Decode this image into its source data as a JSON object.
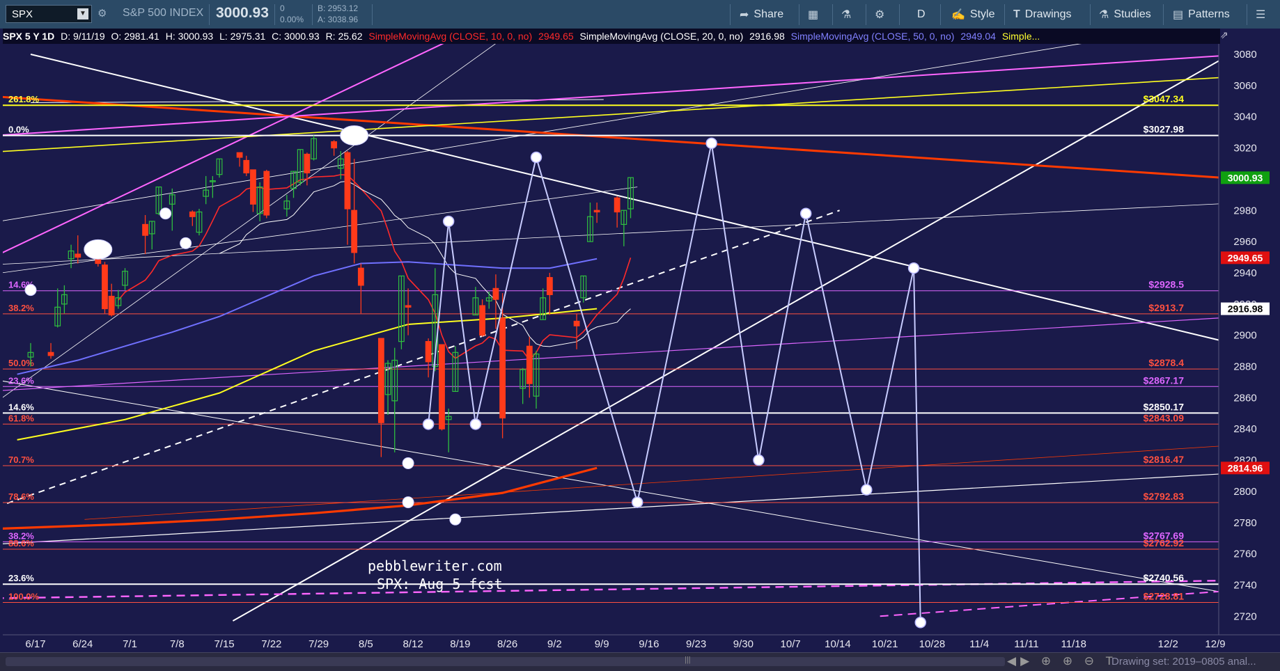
{
  "toolbar": {
    "symbol": "SPX",
    "index_name": "S&P 500 INDEX",
    "last_price": "3000.93",
    "change": "0",
    "change_pct": "0.00%",
    "bid": "B: 2953.12",
    "ask": "A: 3038.96",
    "buttons": {
      "share": "Share",
      "period": "D",
      "style": "Style",
      "drawings": "Drawings",
      "studies": "Studies",
      "patterns": "Patterns"
    }
  },
  "legend": {
    "header": "SPX 5 Y 1D",
    "date": "D: 9/11/19",
    "open": "O: 2981.41",
    "high": "H: 3000.93",
    "low": "L: 2975.31",
    "close": "C: 3000.93",
    "range": "R: 25.62",
    "sma10_label": "SimpleMovingAvg (CLOSE, 10, 0, no)",
    "sma10_value": "2949.65",
    "sma20_label": "SimpleMovingAvg (CLOSE, 20, 0, no)",
    "sma20_value": "2916.98",
    "sma50_label": "SimpleMovingAvg (CLOSE, 50, 0, no)",
    "sma50_value": "2949.04",
    "more": "Simple..."
  },
  "status_bar": {
    "drawing_set": "Drawing set: 2019–0805 anal..."
  },
  "colors": {
    "background": "#1a1a4a",
    "up": "#2fbf3f",
    "down": "#ff3a1a",
    "sma10": "#ff2a2a",
    "sma20": "#ffffff",
    "sma50": "#7070ff",
    "sma100": "#ffff20",
    "sma200": "#ff3a00",
    "fib_red": "#ff5040",
    "fib_violet": "#dd66ff",
    "forecast": "#c8ccff"
  },
  "chart_data": {
    "type": "candlestick",
    "symbol": "SPX",
    "aggregation": "1D",
    "yaxis": {
      "ticks": [
        2720,
        2740,
        2760,
        2780,
        2800,
        2820,
        2840,
        2860,
        2880,
        2900,
        2920,
        2940,
        2960,
        2980,
        3000,
        3020,
        3040,
        3060,
        3080
      ],
      "range": [
        2716,
        3084
      ]
    },
    "xaxis": {
      "tick_labels": [
        "6/17",
        "6/24",
        "7/1",
        "7/8",
        "7/15",
        "7/22",
        "7/29",
        "8/5",
        "8/12",
        "8/19",
        "8/26",
        "9/2",
        "9/9",
        "9/16",
        "9/23",
        "9/30",
        "10/7",
        "10/14",
        "10/21",
        "10/28",
        "11/4",
        "11/11",
        "11/18",
        "12/2",
        "12/9"
      ],
      "tick_day_offsets": [
        0,
        7,
        14,
        21,
        28,
        35,
        42,
        49,
        56,
        63,
        70,
        77,
        84,
        91,
        98,
        105,
        112,
        119,
        126,
        133,
        140,
        147,
        154,
        168,
        175
      ],
      "start": "2019-06-14",
      "end": "2019-12-12"
    },
    "candles": [
      [
        "6/14",
        2886,
        2895,
        2880,
        2889
      ],
      [
        "6/17",
        2889,
        2895,
        2885,
        2887
      ],
      [
        "6/18",
        2906,
        2930,
        2905,
        2918
      ],
      [
        "6/19",
        2920,
        2932,
        2914,
        2926
      ],
      [
        "6/20",
        2949,
        2958,
        2943,
        2954
      ],
      [
        "6/21",
        2952,
        2964,
        2946,
        2950
      ],
      [
        "6/24",
        2951,
        2954,
        2944,
        2946
      ],
      [
        "6/25",
        2945,
        2947,
        2914,
        2917
      ],
      [
        "6/26",
        2925,
        2933,
        2912,
        2913
      ],
      [
        "6/27",
        2919,
        2929,
        2917,
        2924
      ],
      [
        "6/28",
        2932,
        2943,
        2929,
        2941
      ],
      [
        "7/1",
        2971,
        2977,
        2952,
        2964
      ],
      [
        "7/2",
        2965,
        2973,
        2955,
        2973
      ],
      [
        "7/3",
        2978,
        2995,
        2977,
        2995
      ],
      [
        "7/5",
        2984,
        2994,
        2967,
        2990
      ],
      [
        "7/8",
        2979,
        2980,
        2970,
        2976
      ],
      [
        "7/9",
        2966,
        2981,
        2964,
        2979
      ],
      [
        "7/10",
        2989,
        3002,
        2984,
        2993
      ],
      [
        "7/11",
        2999,
        3002,
        2988,
        2999
      ],
      [
        "7/12",
        3003,
        3013,
        3001,
        3013
      ],
      [
        "7/15",
        3017,
        3017,
        3008,
        3014
      ],
      [
        "7/16",
        3012,
        3015,
        3002,
        3004
      ],
      [
        "7/17",
        3006,
        3006,
        2979,
        2984
      ],
      [
        "7/18",
        2978,
        2998,
        2973,
        2995
      ],
      [
        "7/19",
        3005,
        3006,
        2975,
        2977
      ],
      [
        "7/22",
        2981,
        2990,
        2976,
        2986
      ],
      [
        "7/23",
        2994,
        3005,
        2988,
        3005
      ],
      [
        "7/24",
        2998,
        3019,
        2996,
        3019
      ],
      [
        "7/25",
        3016,
        3017,
        2996,
        3004
      ],
      [
        "7/26",
        3013,
        3028,
        3012,
        3026
      ],
      [
        "7/29",
        3024,
        3025,
        3015,
        3020
      ],
      [
        "7/30",
        3007,
        3018,
        3000,
        3013
      ],
      [
        "7/31",
        3017,
        3018,
        2958,
        2981
      ],
      [
        "8/1",
        2980,
        3013,
        2946,
        2953
      ],
      [
        "8/2",
        2943,
        2946,
        2914,
        2932
      ],
      [
        "8/5",
        2898,
        2898,
        2822,
        2844
      ],
      [
        "8/6",
        2862,
        2884,
        2849,
        2882
      ],
      [
        "8/7",
        2858,
        2892,
        2825,
        2884
      ],
      [
        "8/8",
        2896,
        2938,
        2891,
        2938
      ],
      [
        "8/9",
        2919,
        2930,
        2900,
        2918
      ],
      [
        "8/12",
        2896,
        2898,
        2873,
        2883
      ],
      [
        "8/13",
        2880,
        2943,
        2877,
        2926
      ],
      [
        "8/14",
        2894,
        2894,
        2839,
        2840
      ],
      [
        "8/15",
        2846,
        2853,
        2825,
        2848
      ],
      [
        "8/16",
        2864,
        2893,
        2864,
        2889
      ],
      [
        "8/19",
        2913,
        2931,
        2913,
        2924
      ],
      [
        "8/20",
        2919,
        2923,
        2899,
        2900
      ],
      [
        "8/21",
        2922,
        2928,
        2917,
        2924
      ],
      [
        "8/22",
        2930,
        2939,
        2904,
        2923
      ],
      [
        "8/23",
        2911,
        2927,
        2834,
        2847
      ],
      [
        "8/26",
        2866,
        2879,
        2856,
        2878
      ],
      [
        "8/27",
        2893,
        2899,
        2860,
        2869
      ],
      [
        "8/28",
        2861,
        2890,
        2853,
        2888
      ],
      [
        "8/29",
        2910,
        2930,
        2910,
        2924
      ],
      [
        "8/30",
        2937,
        2940,
        2913,
        2926
      ],
      [
        "9/3",
        2909,
        2914,
        2891,
        2906
      ],
      [
        "9/4",
        2924,
        2938,
        2921,
        2938
      ],
      [
        "9/5",
        2960,
        2985,
        2960,
        2976
      ],
      [
        "9/6",
        2980,
        2985,
        2972,
        2979
      ],
      [
        "9/9",
        2988,
        2989,
        2969,
        2979
      ],
      [
        "9/10",
        2971,
        2980,
        2957,
        2980
      ],
      [
        "9/11",
        2981,
        3001,
        2975,
        3001
      ]
    ],
    "moving_averages": [
      {
        "name": "SimpleMovingAvg (CLOSE, 10, 0, no)",
        "color": "#ff2a2a",
        "last": 2949.65
      },
      {
        "name": "SimpleMovingAvg (CLOSE, 20, 0, no)",
        "color": "#ffffff",
        "last": 2916.98
      },
      {
        "name": "SimpleMovingAvg (CLOSE, 50, 0, no)",
        "color": "#7070ff",
        "last": 2949.04
      }
    ],
    "price_levels": [
      {
        "price": 3047.34,
        "label": "$3047.34",
        "fib": "261.8%",
        "color": "#ffff20",
        "fib_color": "#ffff40"
      },
      {
        "price": 3027.98,
        "label": "$3027.98",
        "fib": "0.0%",
        "color": "#ffffff",
        "fib_color": "#ffffff"
      },
      {
        "price": 2928.5,
        "label": "$2928.5",
        "fib": "14.6%",
        "color": "#dd66ff",
        "fib_color": "#dd66ff"
      },
      {
        "price": 2913.7,
        "label": "$2913.7",
        "fib": "38.2%",
        "color": "#ff5040",
        "fib_color": "#ff5040"
      },
      {
        "price": 2878.4,
        "label": "$2878.4",
        "fib": "50.0%",
        "color": "#ff5040",
        "fib_color": "#ff5040"
      },
      {
        "price": 2867.17,
        "label": "$2867.17",
        "fib": "23.6%",
        "color": "#dd66ff",
        "fib_color": "#dd66ff"
      },
      {
        "price": 2850.17,
        "label": "$2850.17",
        "fib": "14.6%",
        "color": "#ffffff",
        "fib_color": "#ffffff"
      },
      {
        "price": 2843.09,
        "label": "$2843.09",
        "fib": "61.8%",
        "color": "#ff5040",
        "fib_color": "#ff5040"
      },
      {
        "price": 2816.47,
        "label": "$2816.47",
        "fib": "70.7%",
        "color": "#ff5040",
        "fib_color": "#ff5040"
      },
      {
        "price": 2792.83,
        "label": "$2792.83",
        "fib": "78.6%",
        "color": "#ff5040",
        "fib_color": "#ff5040"
      },
      {
        "price": 2767.69,
        "label": "$2767.69",
        "fib": "38.2%",
        "color": "#dd66ff",
        "fib_color": "#dd66ff"
      },
      {
        "price": 2762.92,
        "label": "$2762.92",
        "fib": "88.6%",
        "color": "#ff5040",
        "fib_color": "#ff5040"
      },
      {
        "price": 2740.56,
        "label": "$2740.56",
        "fib": "23.6%",
        "color": "#ffffff",
        "fib_color": "#ffffff"
      },
      {
        "price": 2728.81,
        "label": "$2728.81",
        "fib": "100.0%",
        "color": "#ff5040",
        "fib_color": "#ff5040"
      }
    ],
    "axis_tags": [
      {
        "price": 3000.93,
        "label": "3000.93",
        "bg": "#10a010",
        "fg": "#ffffff"
      },
      {
        "price": 2949.65,
        "label": "2949.65",
        "bg": "#e01010",
        "fg": "#ffffff"
      },
      {
        "price": 2916.98,
        "label": "2916.98",
        "bg": "#ffffff",
        "fg": "#000000"
      },
      {
        "price": 2814.96,
        "label": "2814.96",
        "bg": "#e01010",
        "fg": "#ffffff"
      }
    ],
    "forecast_path": [
      [
        "8/12",
        2843
      ],
      [
        "8/15",
        2973
      ],
      [
        "8/19",
        2843
      ],
      [
        "8/28",
        3014
      ],
      [
        "9/12",
        2793
      ],
      [
        "9/23",
        3023
      ],
      [
        "9/30",
        2820
      ],
      [
        "10/7",
        2978
      ],
      [
        "10/16",
        2801
      ],
      [
        "10/23",
        2943
      ],
      [
        "10/24",
        2716
      ]
    ],
    "annotations": [
      "pebblewriter.com",
      "SPX: Aug 5 fcst"
    ]
  }
}
